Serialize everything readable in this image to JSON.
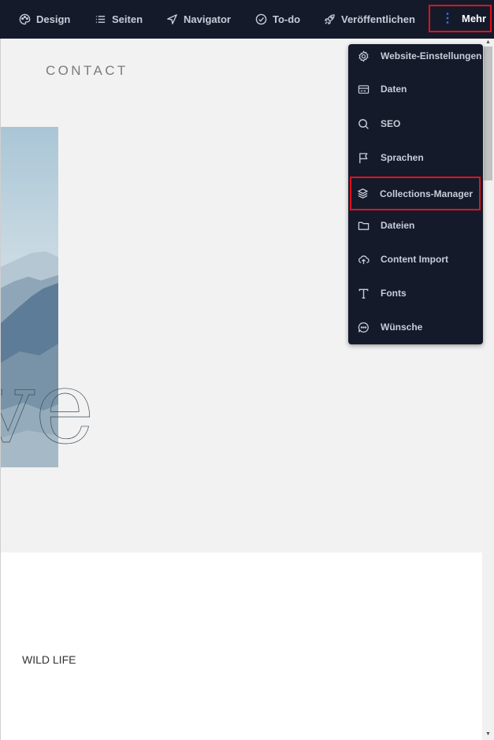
{
  "toolbar": {
    "design": "Design",
    "pages": "Seiten",
    "navigator": "Navigator",
    "todo": "To-do",
    "publish": "Veröffentlichen",
    "more": "Mehr"
  },
  "page": {
    "contact": "CONTACT",
    "hero_word": "ve",
    "wild_life": "WILD LIFE"
  },
  "menu": {
    "items": [
      {
        "label": "Website-Einstellungen",
        "icon": "gear-icon"
      },
      {
        "label": "Daten",
        "icon": "card-icon"
      },
      {
        "label": "SEO",
        "icon": "search-icon"
      },
      {
        "label": "Sprachen",
        "icon": "flag-icon"
      },
      {
        "label": "Collections-Manager",
        "icon": "layers-icon"
      },
      {
        "label": "Dateien",
        "icon": "folder-icon"
      },
      {
        "label": "Content Import",
        "icon": "cloud-upload-icon"
      },
      {
        "label": "Fonts",
        "icon": "text-icon"
      },
      {
        "label": "Wünsche",
        "icon": "chat-icon"
      }
    ]
  },
  "colors": {
    "toolbar_bg": "#151a2b",
    "highlight": "#e0121c",
    "accent": "#2a78ff"
  }
}
